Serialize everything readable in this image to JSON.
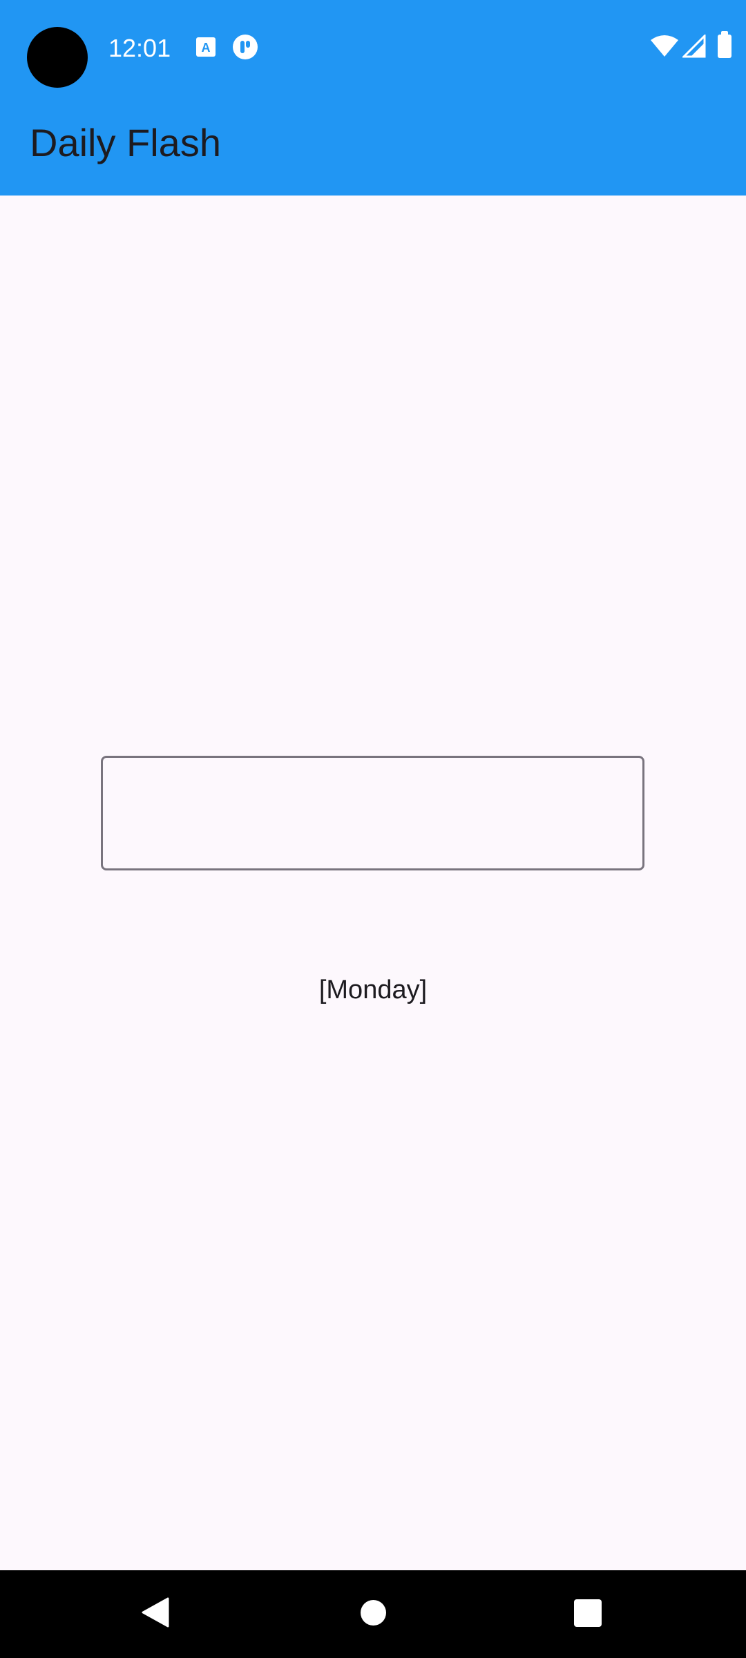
{
  "status_bar": {
    "time": "12:01"
  },
  "app_bar": {
    "title": "Daily Flash",
    "background_color": "#2196f3"
  },
  "main": {
    "input": {
      "value": "",
      "placeholder": ""
    },
    "day_label": "[Monday]"
  },
  "nav_bar": {
    "icons": [
      "back-icon",
      "home-icon",
      "recents-icon"
    ]
  }
}
